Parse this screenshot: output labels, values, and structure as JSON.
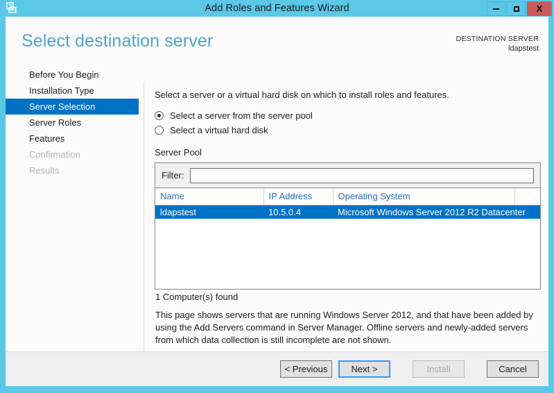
{
  "window": {
    "title": "Add Roles and Features Wizard",
    "icon": "wizard-toolbox-icon",
    "controls": {
      "minimize": "–",
      "maximize": "□",
      "close": "X"
    },
    "accent_titlebar_color": "#5bc8e8",
    "close_button_color": "#c75b5b"
  },
  "header": {
    "page_title": "Select destination server",
    "destination_label": "DESTINATION SERVER",
    "destination_value": "ldapstest",
    "title_color": "#4fa3d1"
  },
  "sidebar": {
    "items": [
      {
        "label": "Before You Begin",
        "state": "normal"
      },
      {
        "label": "Installation Type",
        "state": "normal"
      },
      {
        "label": "Server Selection",
        "state": "selected"
      },
      {
        "label": "Server Roles",
        "state": "normal"
      },
      {
        "label": "Features",
        "state": "normal"
      },
      {
        "label": "Confirmation",
        "state": "disabled"
      },
      {
        "label": "Results",
        "state": "disabled"
      }
    ],
    "selected_color": "#0072c6"
  },
  "main": {
    "intro": "Select a server or a virtual hard disk on which to install roles and features.",
    "radio_options": [
      {
        "label": "Select a server from the server pool",
        "checked": true
      },
      {
        "label": "Select a virtual hard disk",
        "checked": false
      }
    ],
    "server_pool_title": "Server Pool",
    "filter": {
      "label": "Filter:",
      "value": "",
      "placeholder": ""
    },
    "table": {
      "columns": [
        "Name",
        "IP Address",
        "Operating System",
        ""
      ],
      "rows": [
        {
          "name": "ldapstest",
          "ip_address": "10.5.0.4",
          "operating_system": "Microsoft Windows Server 2012 R2 Datacenter",
          "extra": "",
          "selected": true
        }
      ],
      "header_color": "#2b6cb8",
      "row_selected_color": "#0072c6"
    },
    "found_text": "1 Computer(s) found",
    "note": "This page shows servers that are running Windows Server 2012, and that have been added by using the Add Servers command in Server Manager. Offline servers and newly-added servers from which data collection is still incomplete are not shown."
  },
  "footer": {
    "previous_label": "< Previous",
    "next_label": "Next >",
    "install_label": "Install",
    "cancel_label": "Cancel",
    "install_enabled": false,
    "next_focused": true
  }
}
